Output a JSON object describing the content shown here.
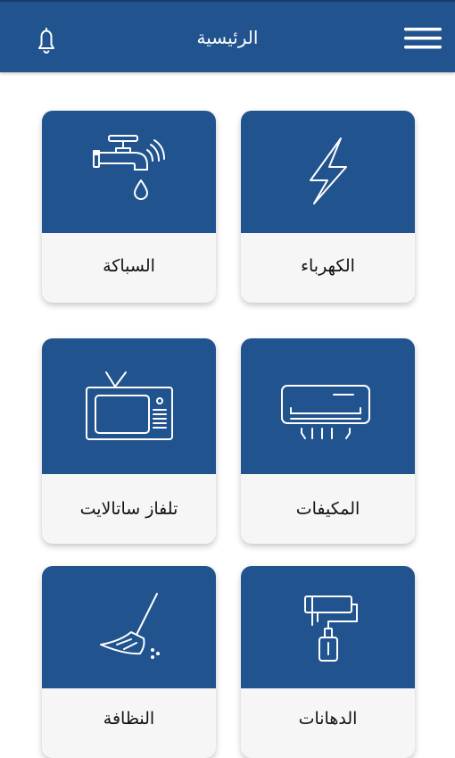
{
  "header": {
    "title": "الرئيسية",
    "background": "#21538f"
  },
  "icons": {
    "menu": "hamburger-menu-icon",
    "notifications": "bell-icon"
  },
  "services": [
    {
      "label": "الكهرباء",
      "icon": "lightning-bolt-icon"
    },
    {
      "label": "السباكة",
      "icon": "water-faucet-icon"
    },
    {
      "label": "المكيفات",
      "icon": "air-conditioner-icon"
    },
    {
      "label": "تلفاز ساتالايت",
      "icon": "television-icon"
    },
    {
      "label": "الدهانات",
      "icon": "paint-roller-icon"
    },
    {
      "label": "النظافة",
      "icon": "broom-icon"
    }
  ],
  "colors": {
    "primary": "#21538f",
    "card_bottom": "#f6f6f6",
    "page_background": "#ffffff"
  }
}
